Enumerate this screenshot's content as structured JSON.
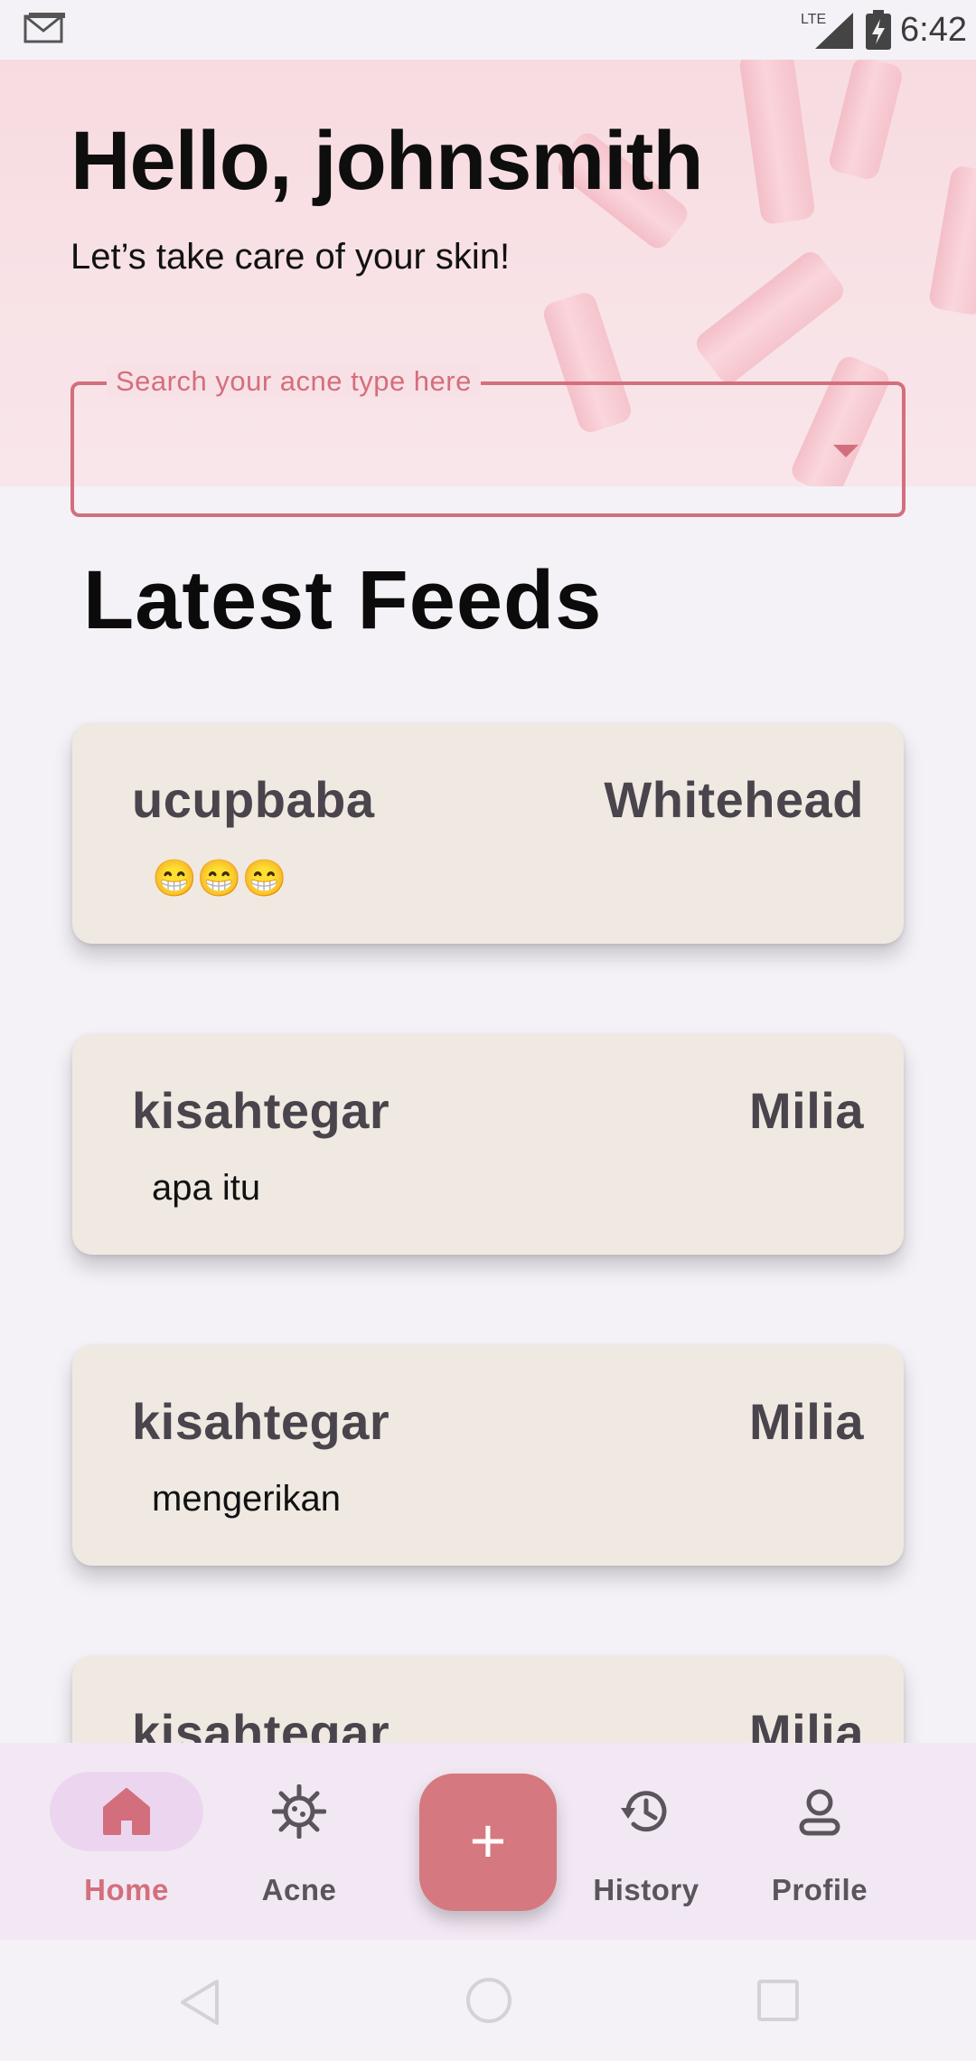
{
  "status_bar": {
    "time": "6:42",
    "network": "LTE",
    "icons": [
      "mail-icon",
      "signal-icon",
      "battery-charging-icon"
    ]
  },
  "header": {
    "greeting": "Hello, johnsmith",
    "subtitle": "Let’s take care of your skin!"
  },
  "search": {
    "label": "Search your acne type here",
    "value": ""
  },
  "section_title": "Latest Feeds",
  "feeds": [
    {
      "user": "ucupbaba",
      "type": "Whitehead",
      "text": "😁😁😁"
    },
    {
      "user": "kisahtegar",
      "type": "Milia",
      "text": "apa itu"
    },
    {
      "user": "kisahtegar",
      "type": "Milia",
      "text": "mengerikan"
    },
    {
      "user": "kisahtegar",
      "type": "Milia",
      "text": ""
    }
  ],
  "bottom_nav": {
    "items": [
      {
        "label": "Home",
        "icon": "home-icon",
        "active": true
      },
      {
        "label": "Acne",
        "icon": "virus-icon",
        "active": false
      },
      {
        "label": "History",
        "icon": "history-icon",
        "active": false
      },
      {
        "label": "Profile",
        "icon": "profile-icon",
        "active": false
      }
    ],
    "fab_label": "+"
  },
  "colors": {
    "accent": "#d36f7c",
    "card": "#efe9e2",
    "nav_bg": "#f2e8f4"
  }
}
